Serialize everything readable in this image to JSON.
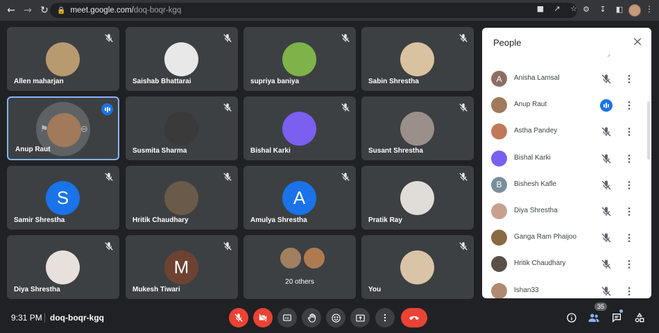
{
  "browser": {
    "url_host": "meet.google.com/",
    "url_path": "doq-boqr-kgq"
  },
  "colors": {
    "tile_bg": "#3c4043",
    "accent_blue": "#1a73e8",
    "end_call_red": "#ea4335"
  },
  "tiles": [
    {
      "name": "Allen maharjan",
      "avatar": "photo",
      "color": "#b89a70",
      "muted": true
    },
    {
      "name": "Saishab Bhattarai",
      "avatar": "photo",
      "color": "#e8e8e8",
      "muted": true
    },
    {
      "name": "supriya baniya",
      "avatar": "photo",
      "color": "#7fb34a",
      "muted": true
    },
    {
      "name": "Sabin Shrestha",
      "avatar": "photo",
      "color": "#d9c2a0",
      "muted": true
    },
    {
      "name": "Anup Raut",
      "avatar": "photo",
      "color": "#a07a5a",
      "muted": false,
      "speaking": true
    },
    {
      "name": "Susmita Sharma",
      "avatar": "photo",
      "color": "#3a3a3a",
      "muted": true
    },
    {
      "name": "Bishal Karki",
      "avatar": "photo",
      "color": "#7b5ff0",
      "muted": true
    },
    {
      "name": "Susant Shrestha",
      "avatar": "photo",
      "color": "#9a8f8a",
      "muted": true
    },
    {
      "name": "Samir Shrestha",
      "avatar": "S",
      "color": "#1a73e8",
      "muted": true
    },
    {
      "name": "Hritik Chaudhary",
      "avatar": "photo",
      "color": "#6a5a4a",
      "muted": true
    },
    {
      "name": "Amulya Shrestha",
      "avatar": "A",
      "color": "#1a73e8",
      "muted": true
    },
    {
      "name": "Pratik Ray",
      "avatar": "photo",
      "color": "#e0dcd8",
      "muted": true
    },
    {
      "name": "Diya Shrestha",
      "avatar": "photo",
      "color": "#e8e0dc",
      "muted": true
    },
    {
      "name": "Mukesh Tiwari",
      "avatar": "M",
      "color": "#6d4233",
      "muted": true
    },
    {
      "name": "20 others",
      "avatar": "others",
      "color": "#3c4043",
      "muted": false
    },
    {
      "name": "You",
      "avatar": "photo",
      "color": "#d9c4a8",
      "muted": true
    }
  ],
  "bottom_bar": {
    "time": "9:31 PM",
    "meeting_code": "doq-boqr-kgq",
    "participants_count": "35"
  },
  "people_panel": {
    "title": "People",
    "people": [
      {
        "name": "Anisha Lamsal",
        "avatar": "A",
        "color": "#8d6e63",
        "speaking": false
      },
      {
        "name": "Anup Raut",
        "avatar": "photo",
        "color": "#a07a5a",
        "speaking": true
      },
      {
        "name": "Astha Pandey",
        "avatar": "photo",
        "color": "#c0785a",
        "speaking": false
      },
      {
        "name": "Bishal Karki",
        "avatar": "photo",
        "color": "#7b5ff0",
        "speaking": false
      },
      {
        "name": "Bishesh Kafle",
        "avatar": "B",
        "color": "#78909c",
        "speaking": false
      },
      {
        "name": "Diya Shrestha",
        "avatar": "photo",
        "color": "#c8a090",
        "speaking": false
      },
      {
        "name": "Ganga Ram Phaijoo",
        "avatar": "photo",
        "color": "#8a6a40",
        "speaking": false
      },
      {
        "name": "Hritik Chaudhary",
        "avatar": "photo",
        "color": "#5a5048",
        "speaking": false
      },
      {
        "name": "Ishan33",
        "avatar": "photo",
        "color": "#b08a70",
        "speaking": false
      }
    ]
  }
}
